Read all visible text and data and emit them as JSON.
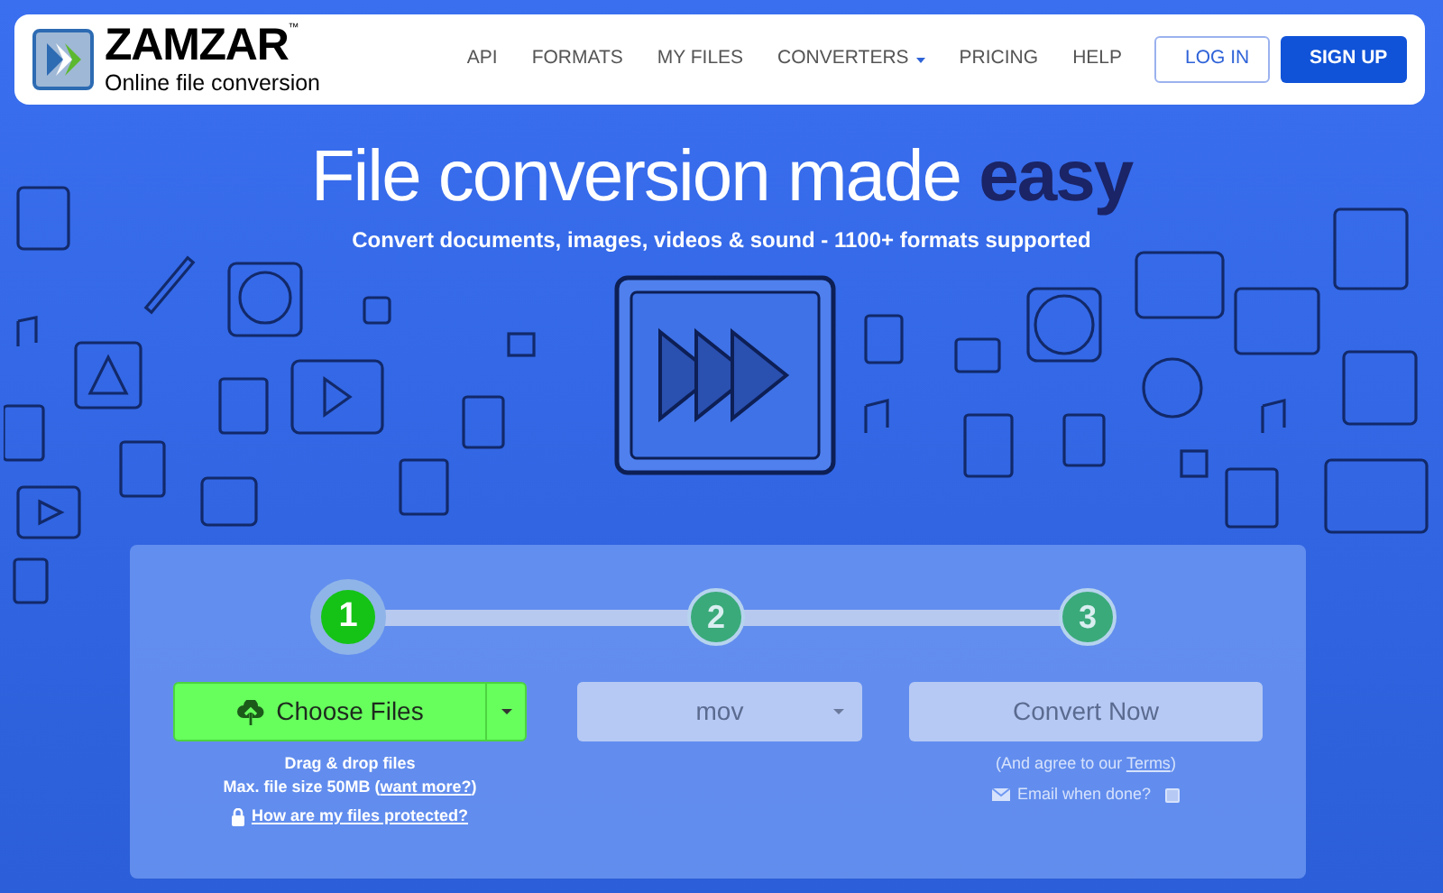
{
  "header": {
    "logo": {
      "name": "ZAMZAR",
      "trademark": "™",
      "tagline": "Online file conversion"
    },
    "nav": [
      {
        "label": "API",
        "dropdown": false
      },
      {
        "label": "FORMATS",
        "dropdown": false
      },
      {
        "label": "MY FILES",
        "dropdown": false
      },
      {
        "label": "CONVERTERS",
        "dropdown": true
      },
      {
        "label": "PRICING",
        "dropdown": false
      },
      {
        "label": "HELP",
        "dropdown": false
      }
    ],
    "buttons": [
      {
        "label": "LOG IN",
        "kind": "outline"
      },
      {
        "label": "SIGN UP",
        "kind": "solid"
      }
    ]
  },
  "hero": {
    "title": "File conversion made **easy**",
    "subtitle": "Convert documents, images, videos & sound - 1100+ formats supported"
  },
  "steps": [
    {
      "number": "1",
      "selected": true
    },
    {
      "number": "2",
      "selected": false
    },
    {
      "number": "3",
      "selected": false
    }
  ],
  "upload": {
    "button": "Choose Files",
    "hint": "Drag & drop files",
    "size_note": "Max. file size 50MB (",
    "size_link": "want more?",
    "size_note_end": ")",
    "protect_link": "How are my files protected?"
  },
  "format": {
    "value": "mov"
  },
  "convert": {
    "button": "Convert Now",
    "terms_prefix": "(And agree to our ",
    "terms_link": "Terms",
    "terms_suffix": ")",
    "email_label": "Email when done?",
    "email_checked": false
  }
}
